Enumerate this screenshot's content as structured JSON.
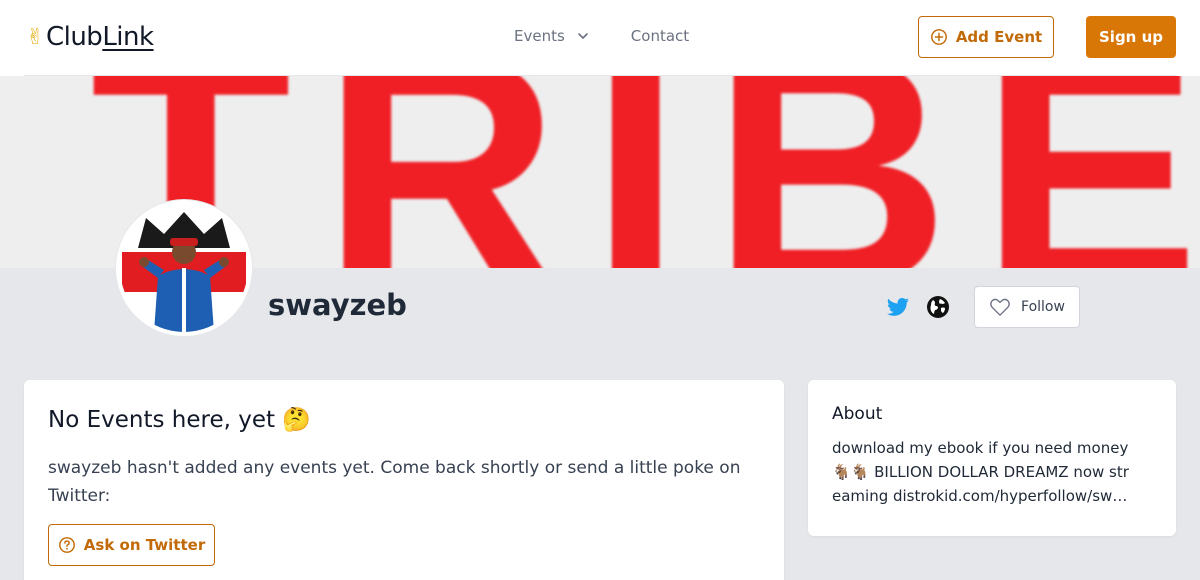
{
  "header": {
    "logo_prefix": "Club",
    "logo_suffix": "Link",
    "nav": {
      "events_label": "Events",
      "contact_label": "Contact"
    },
    "add_event_label": "Add Event",
    "sign_up_label": "Sign up"
  },
  "banner": {
    "text": "TRIBE"
  },
  "profile": {
    "username": "swayzeb",
    "follow_label": "Follow",
    "social_icons": [
      "twitter-icon",
      "globe-icon"
    ]
  },
  "events_card": {
    "title": "No Events here, yet 🤔",
    "description": "swayzeb hasn't added any events yet. Come back shortly or send a little poke on Twitter:",
    "ask_label": "Ask on Twitter"
  },
  "about_card": {
    "title": "About",
    "text": "download my ebook if you need money🐐🐐 BILLION DOLLAR DREAMZ now streaming distrokid.com/hyperfollow/swayzeb"
  },
  "colors": {
    "accent": "#d97706",
    "accent_text": "#c26a07",
    "twitter": "#1da1f2",
    "banner_red": "#ef1f25"
  }
}
